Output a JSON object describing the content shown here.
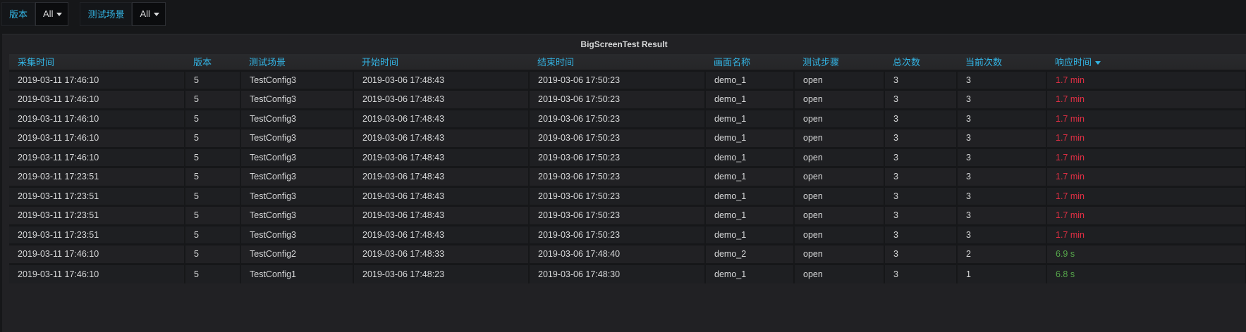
{
  "filters": [
    {
      "label": "版本",
      "value": "All"
    },
    {
      "label": "测试场景",
      "value": "All"
    }
  ],
  "panel": {
    "title": "BigScreenTest Result"
  },
  "table": {
    "columns": [
      "采集时间",
      "版本",
      "测试场景",
      "开始时间",
      "结束时间",
      "画面名称",
      "测试步骤",
      "总次数",
      "当前次数",
      "响应时间"
    ],
    "sorted_column": "响应时间",
    "rows": [
      [
        "2019-03-11 17:46:10",
        "5",
        "TestConfig3",
        "2019-03-06 17:48:43",
        "2019-03-06 17:50:23",
        "demo_1",
        "open",
        "3",
        "3",
        "1.7 min"
      ],
      [
        "2019-03-11 17:46:10",
        "5",
        "TestConfig3",
        "2019-03-06 17:48:43",
        "2019-03-06 17:50:23",
        "demo_1",
        "open",
        "3",
        "3",
        "1.7 min"
      ],
      [
        "2019-03-11 17:46:10",
        "5",
        "TestConfig3",
        "2019-03-06 17:48:43",
        "2019-03-06 17:50:23",
        "demo_1",
        "open",
        "3",
        "3",
        "1.7 min"
      ],
      [
        "2019-03-11 17:46:10",
        "5",
        "TestConfig3",
        "2019-03-06 17:48:43",
        "2019-03-06 17:50:23",
        "demo_1",
        "open",
        "3",
        "3",
        "1.7 min"
      ],
      [
        "2019-03-11 17:46:10",
        "5",
        "TestConfig3",
        "2019-03-06 17:48:43",
        "2019-03-06 17:50:23",
        "demo_1",
        "open",
        "3",
        "3",
        "1.7 min"
      ],
      [
        "2019-03-11 17:23:51",
        "5",
        "TestConfig3",
        "2019-03-06 17:48:43",
        "2019-03-06 17:50:23",
        "demo_1",
        "open",
        "3",
        "3",
        "1.7 min"
      ],
      [
        "2019-03-11 17:23:51",
        "5",
        "TestConfig3",
        "2019-03-06 17:48:43",
        "2019-03-06 17:50:23",
        "demo_1",
        "open",
        "3",
        "3",
        "1.7 min"
      ],
      [
        "2019-03-11 17:23:51",
        "5",
        "TestConfig3",
        "2019-03-06 17:48:43",
        "2019-03-06 17:50:23",
        "demo_1",
        "open",
        "3",
        "3",
        "1.7 min"
      ],
      [
        "2019-03-11 17:23:51",
        "5",
        "TestConfig3",
        "2019-03-06 17:48:43",
        "2019-03-06 17:50:23",
        "demo_1",
        "open",
        "3",
        "3",
        "1.7 min"
      ],
      [
        "2019-03-11 17:46:10",
        "5",
        "TestConfig2",
        "2019-03-06 17:48:33",
        "2019-03-06 17:48:40",
        "demo_2",
        "open",
        "3",
        "2",
        "6.9 s"
      ],
      [
        "2019-03-11 17:46:10",
        "5",
        "TestConfig1",
        "2019-03-06 17:48:23",
        "2019-03-06 17:48:30",
        "demo_1",
        "open",
        "3",
        "1",
        "6.8 s"
      ]
    ],
    "row_status": [
      "red",
      "red",
      "red",
      "red",
      "red",
      "red",
      "red",
      "red",
      "red",
      "green",
      "green"
    ]
  },
  "colors": {
    "accent": "#33b5e5",
    "alert": "#e02f44",
    "ok": "#56a64b"
  }
}
